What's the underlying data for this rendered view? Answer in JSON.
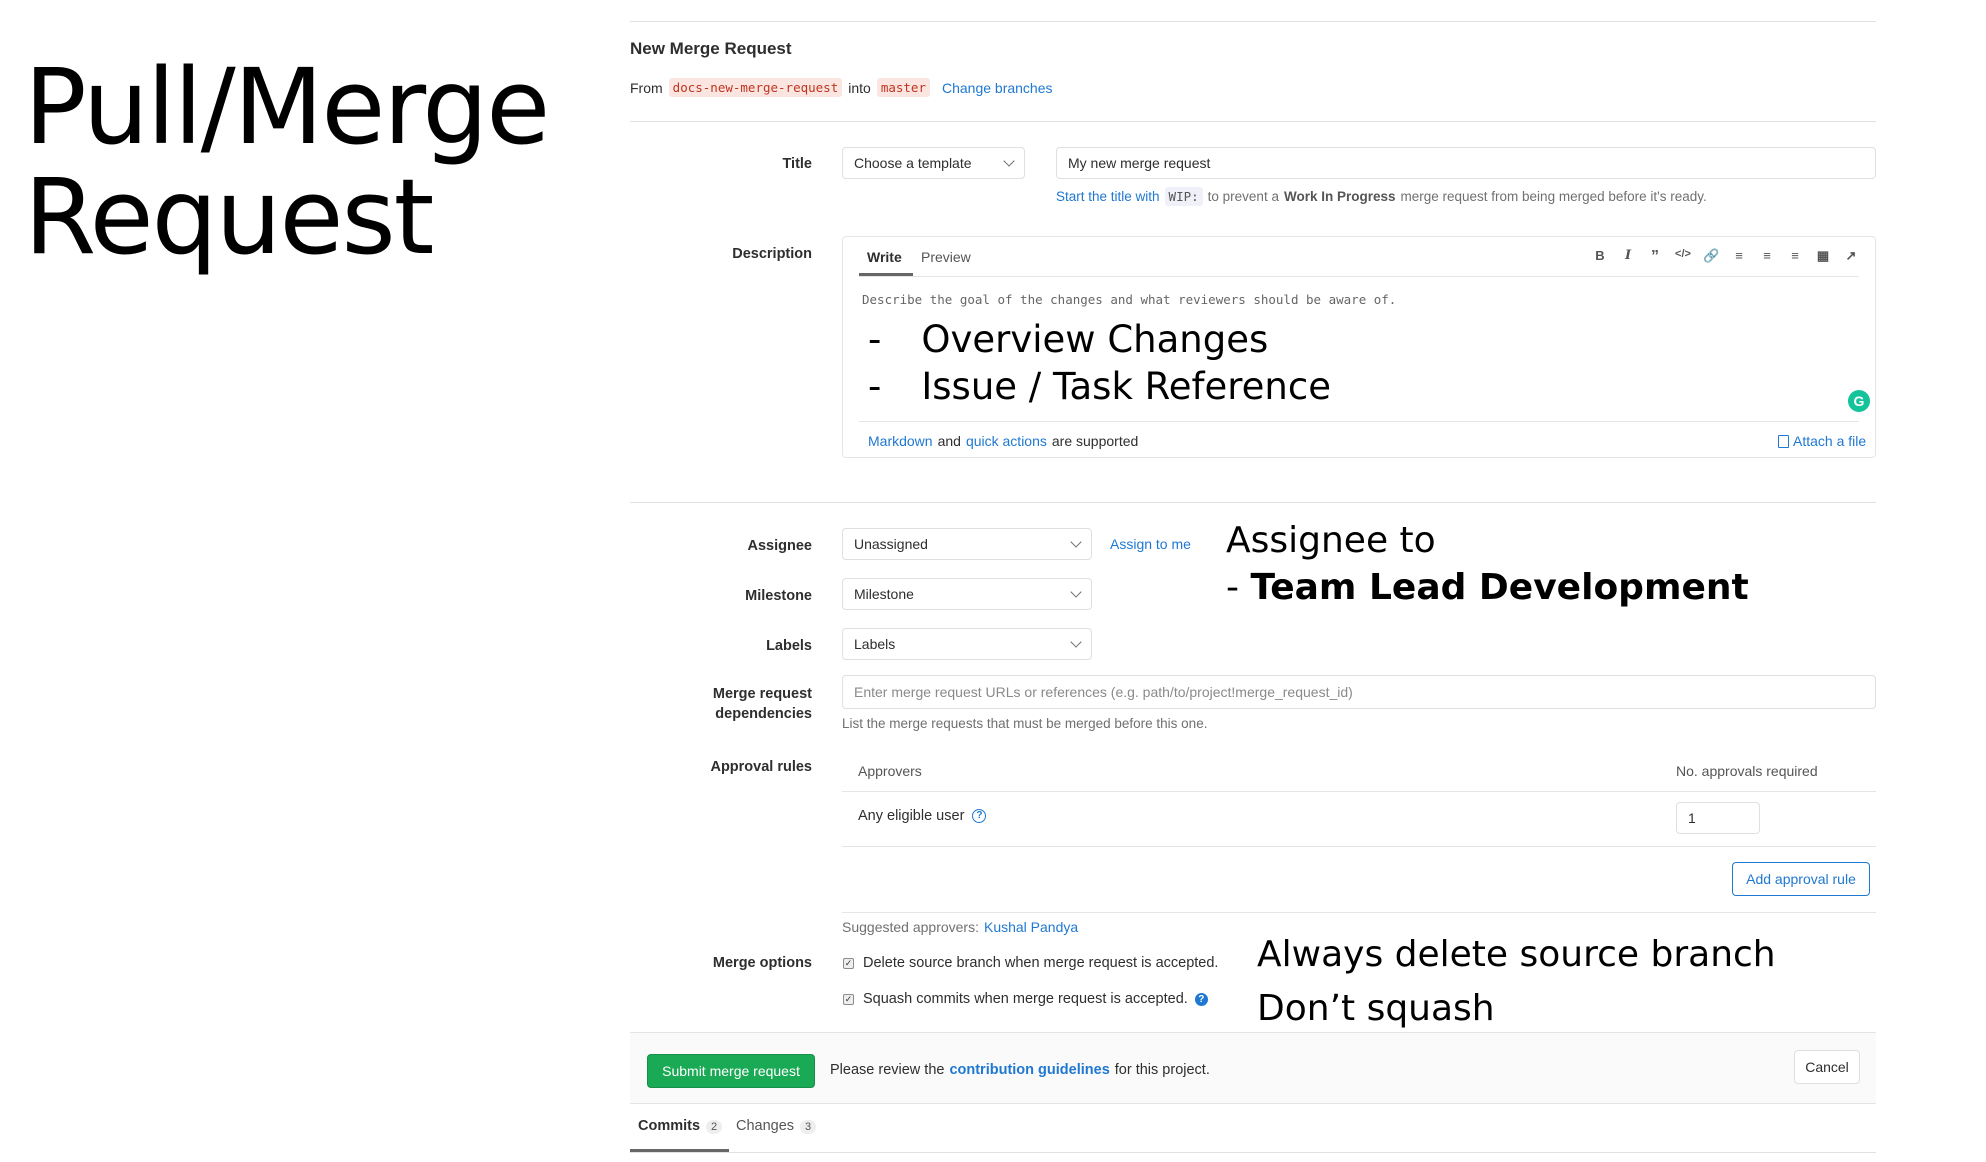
{
  "slide": {
    "title_line1": "Pull/Merge",
    "title_line2": "Request"
  },
  "header": {
    "title": "New Merge Request",
    "from_label": "From",
    "source_branch": "docs-new-merge-request",
    "into_label": "into",
    "target_branch": "master",
    "change_branches": "Change branches"
  },
  "title_field": {
    "label": "Title",
    "template_select": "Choose a template",
    "value": "My new merge request",
    "hint_link": "Start the title with",
    "hint_code": "WIP:",
    "hint_mid": "to prevent a",
    "hint_bold": "Work In Progress",
    "hint_end": "merge request from being merged before it's ready."
  },
  "description": {
    "label": "Description",
    "tab_write": "Write",
    "tab_preview": "Preview",
    "placeholder": "Describe the goal of the changes and what reviewers should be aware of.",
    "bullet_dash": "-",
    "bullet1": "Overview Changes",
    "bullet2": "Issue / Task Reference",
    "toolbar": [
      "bold-icon",
      "italic-icon",
      "quote-icon",
      "code-icon",
      "link-icon",
      "bullet-list-icon",
      "numbered-list-icon",
      "task-list-icon",
      "table-icon",
      "fullscreen-icon"
    ],
    "markdown_link": "Markdown",
    "and_text": "and",
    "quick_actions_link": "quick actions",
    "supported_text": "are supported",
    "attach_file": "Attach a file",
    "grammarly_glyph": "G"
  },
  "assignee": {
    "label": "Assignee",
    "value": "Unassigned",
    "assign_to_me": "Assign to me"
  },
  "milestone": {
    "label": "Milestone",
    "value": "Milestone"
  },
  "labels": {
    "label": "Labels",
    "value": "Labels"
  },
  "dependencies": {
    "label_line1": "Merge request",
    "label_line2": "dependencies",
    "placeholder": "Enter merge request URLs or references (e.g. path/to/project!merge_request_id)",
    "hint": "List the merge requests that must be merged before this one."
  },
  "approval_rules": {
    "label": "Approval rules",
    "col_approvers": "Approvers",
    "col_required": "No. approvals required",
    "rule_name": "Any eligible user",
    "rule_required": "1",
    "add_rule": "Add approval rule",
    "suggested_label": "Suggested approvers:",
    "suggested_user": "Kushal Pandya"
  },
  "merge_options": {
    "label": "Merge options",
    "delete_branch": "Delete source branch when merge request is accepted.",
    "squash": "Squash commits when merge request is accepted."
  },
  "annotations": {
    "assignee_line1": "Assignee to",
    "assignee_line2_prefix": "- ",
    "assignee_line2_bold": "Team Lead Development",
    "delete_branch": "Always delete source branch",
    "squash": "Don’t squash"
  },
  "footer": {
    "submit": "Submit merge request",
    "review_prefix": "Please review the",
    "review_link": "contribution guidelines",
    "review_suffix": "for this project.",
    "cancel": "Cancel"
  },
  "bottom_tabs": {
    "commits_label": "Commits",
    "commits_count": "2",
    "changes_label": "Changes",
    "changes_count": "3"
  },
  "colors": {
    "link": "#1f78d1",
    "submit": "#1aaa55",
    "branch_code": "#c0341d",
    "grammarly": "#15c39a"
  }
}
